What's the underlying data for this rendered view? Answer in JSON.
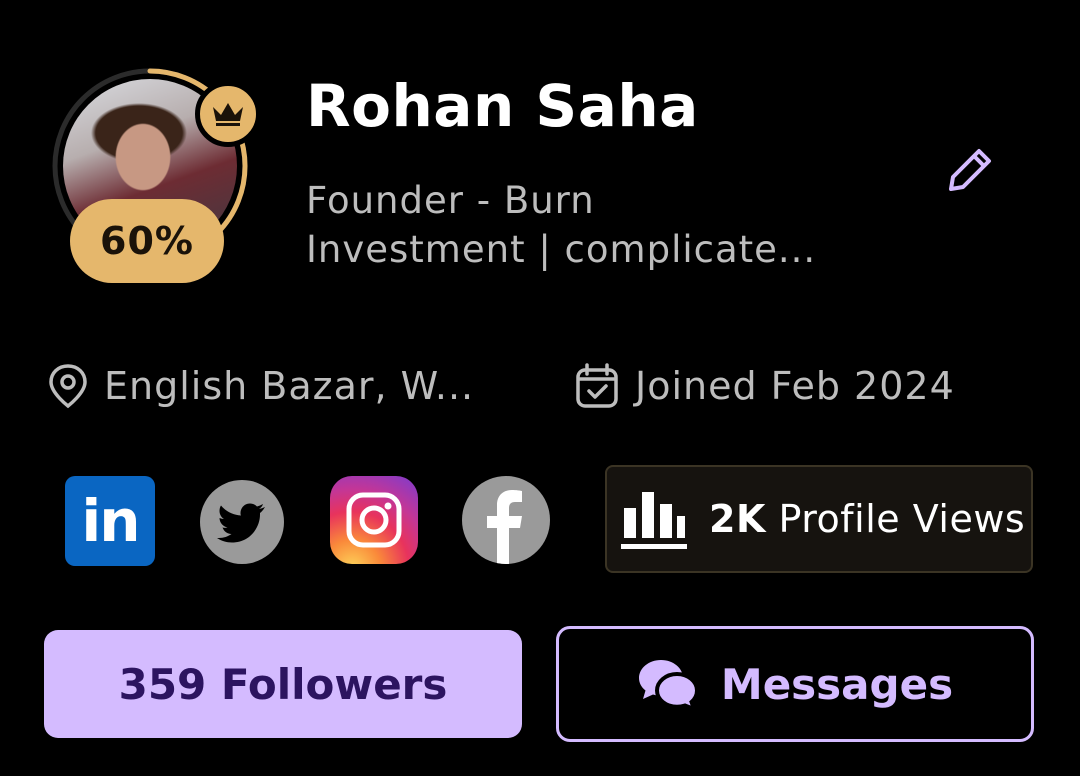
{
  "profile": {
    "name": "Rohan Saha",
    "bio_line1": "Founder - Burn",
    "bio_line2": "Investment | complicate...",
    "completion": "60%",
    "badge_icon": "crown-icon"
  },
  "meta": {
    "location": "English Bazar, W...",
    "joined": "Joined Feb 2024"
  },
  "social": {
    "linkedin_text": "in"
  },
  "stats": {
    "views_count": "2K",
    "views_label": "Profile Views"
  },
  "actions": {
    "followers": "359 Followers",
    "messages": "Messages"
  },
  "colors": {
    "accent": "#d4bbff",
    "gold": "#e5b76c",
    "linkedin": "#0a66c2",
    "background": "#000000"
  }
}
